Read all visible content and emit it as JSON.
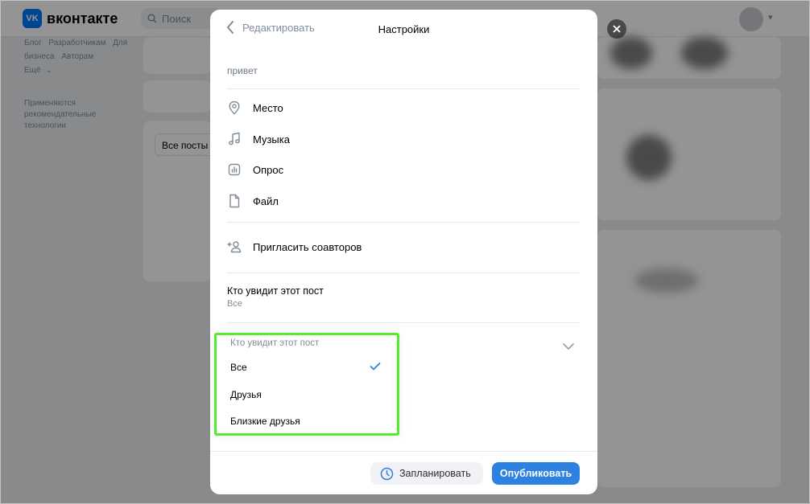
{
  "background": {
    "logo_mark": "VK",
    "logo_text": "вконтакте",
    "search_placeholder": "Поиск",
    "footer_links": [
      "Блог",
      "Разработчикам",
      "Для бизнеса",
      "Авторам",
      "Ещё"
    ],
    "tech_note": "Применяются рекомендательные технологии",
    "filter_label": "Все посты"
  },
  "modal": {
    "back_label": "Редактировать",
    "title": "Настройки",
    "post_text": "привет",
    "attachments": [
      {
        "label": "Место",
        "icon": "location-pin-icon"
      },
      {
        "label": "Музыка",
        "icon": "music-note-icon"
      },
      {
        "label": "Опрос",
        "icon": "poll-chart-icon"
      },
      {
        "label": "Файл",
        "icon": "file-icon"
      }
    ],
    "invite_label": "Пригласить соавторов",
    "visibility": {
      "title": "Кто увидит этот пост",
      "value": "Все"
    },
    "dropdown": {
      "header": "Кто увидит этот пост",
      "options": [
        "Все",
        "Друзья",
        "Близкие друзья"
      ],
      "selected": "Все"
    },
    "footer": {
      "schedule_label": "Запланировать",
      "publish_label": "Опубликовать"
    }
  },
  "colors": {
    "accent": "#2d81e0",
    "highlight": "#55ec2f",
    "secondary_text": "#818c99"
  }
}
